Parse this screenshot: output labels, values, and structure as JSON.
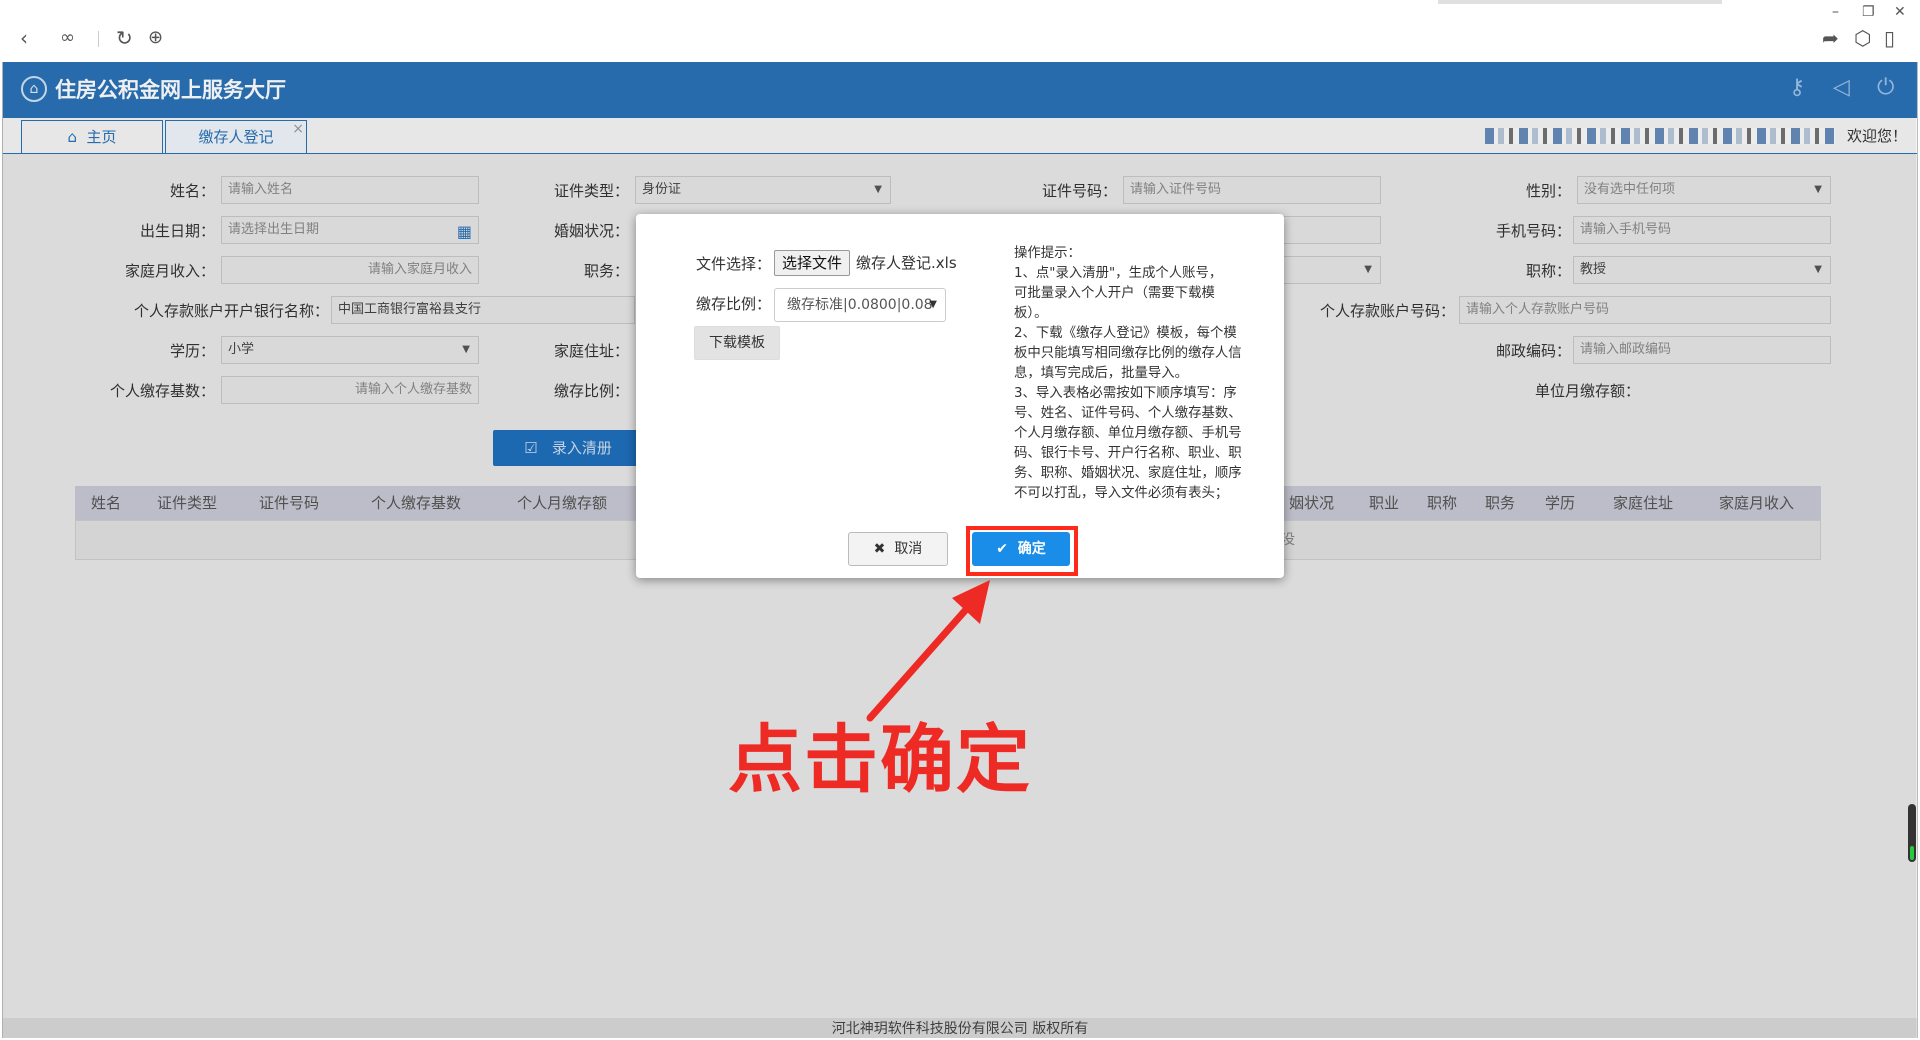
{
  "browser": {
    "icons": [
      "back-arrow-icon",
      "link-icon",
      "reload-icon",
      "globe-icon",
      "share-icon",
      "cube-icon",
      "phone-icon",
      "minimize-icon",
      "restore-icon",
      "close-icon"
    ]
  },
  "app": {
    "title": "住房公积金网上服务大厅",
    "tabs": {
      "home": "主页",
      "current": "缴存人登记"
    },
    "welcome": "欢迎您！"
  },
  "form": {
    "name": {
      "label": "姓名：",
      "placeholder": "请输入姓名"
    },
    "id_type": {
      "label": "证件类型：",
      "value": "身份证"
    },
    "id_number": {
      "label": "证件号码：",
      "placeholder": "请输入证件号码"
    },
    "gender": {
      "label": "性别：",
      "value": "没有选中任何项"
    },
    "birth_date": {
      "label": "出生日期：",
      "placeholder": "请选择出生日期"
    },
    "marital": {
      "label": "婚姻状况："
    },
    "mobile": {
      "label": "手机号码：",
      "placeholder": "请输入手机号码"
    },
    "family_income": {
      "label": "家庭月收入：",
      "placeholder": "请输入家庭月收入"
    },
    "position": {
      "label": "职务："
    },
    "title_rank": {
      "label": "职称：",
      "value": "教授"
    },
    "bank_name": {
      "label": "个人存款账户开户银行名称：",
      "value": "中国工商银行富裕县支行"
    },
    "bank_account": {
      "label": "个人存款账户号码：",
      "placeholder": "请输入个人存款账户号码"
    },
    "education": {
      "label": "学历：",
      "value": "小学"
    },
    "address": {
      "label": "家庭住址："
    },
    "postcode": {
      "label": "邮政编码：",
      "placeholder": "请输入邮政编码"
    },
    "deposit_base": {
      "label": "个人缴存基数：",
      "placeholder": "请输入个人缴存基数"
    },
    "deposit_ratio": {
      "label": "缴存比例："
    },
    "unit_monthly": {
      "label": "单位月缴存额："
    },
    "enroll_button": "录入清册"
  },
  "grid": {
    "columns": [
      "姓名",
      "证件类型",
      "证件号码",
      "个人缴存基数",
      "个人月缴存额",
      "姻状况",
      "职业",
      "职称",
      "职务",
      "学历",
      "家庭住址",
      "家庭月收入"
    ],
    "tail_text": "没"
  },
  "footer": "河北神玥软件科技股份有限公司 版权所有",
  "modal": {
    "file_label": "文件选择：",
    "file_button": "选择文件",
    "file_name": "缴存人登记.xls",
    "ratio_label": "缴存比例：",
    "ratio_value": "缴存标准|0.0800|0.08",
    "download_button": "下载模板",
    "tips": [
      "操作提示：",
      "1、点\"录入清册\"，生成个人账号，",
      "可批量录入个人开户（需要下载模",
      "板）。",
      "2、下载《缴存人登记》模板，每个模",
      "板中只能填写相同缴存比例的缴存人信",
      "息，填写完成后，批量导入。",
      "3、导入表格必需按如下顺序填写：序",
      "号、姓名、证件号码、个人缴存基数、",
      "个人月缴存额、单位月缴存额、手机号",
      "码、银行卡号、开户行名称、职业、职",
      "务、职称、婚姻状况、家庭住址，顺序",
      "不可以打乱，导入文件必须有表头；"
    ],
    "cancel_button": "取消",
    "ok_button": "确定"
  },
  "annotation": {
    "text": "点击确定",
    "color": "#ee2a24"
  }
}
